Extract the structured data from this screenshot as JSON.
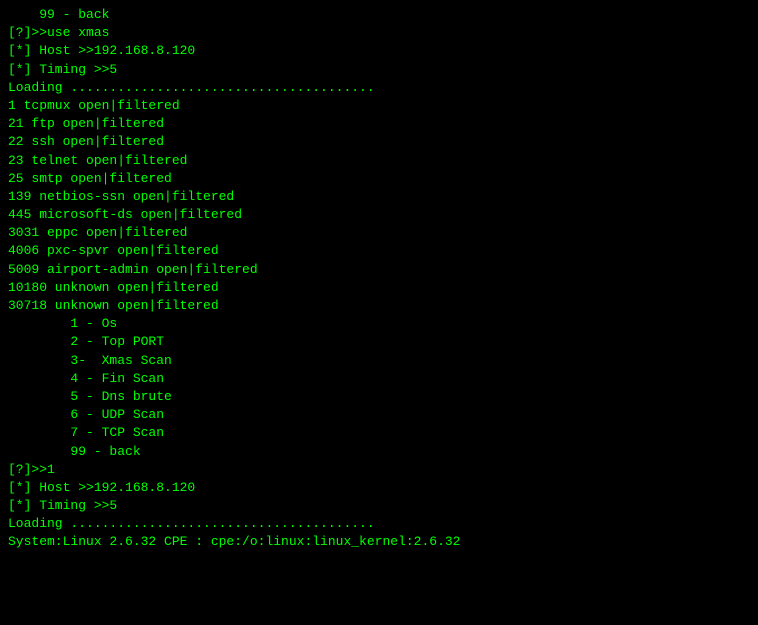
{
  "terminal": {
    "lines": [
      "    99 - back",
      "",
      "[?]>>use xmas",
      "[*] Host >>192.168.8.120",
      "[*] Timing >>5",
      "Loading .......................................",
      "1 tcpmux open|filtered",
      "21 ftp open|filtered",
      "22 ssh open|filtered",
      "23 telnet open|filtered",
      "25 smtp open|filtered",
      "139 netbios-ssn open|filtered",
      "445 microsoft-ds open|filtered",
      "3031 eppc open|filtered",
      "4006 pxc-spvr open|filtered",
      "5009 airport-admin open|filtered",
      "10180 unknown open|filtered",
      "30718 unknown open|filtered",
      "",
      "        1 - Os",
      "        2 - Top PORT",
      "        3-  Xmas Scan",
      "        4 - Fin Scan",
      "        5 - Dns brute",
      "        6 - UDP Scan",
      "        7 - TCP Scan",
      "        99 - back",
      "",
      "[?]>>1",
      "[*] Host >>192.168.8.120",
      "[*] Timing >>5",
      "Loading .......................................",
      "System:Linux 2.6.32 CPE : cpe:/o:linux:linux_kernel:2.6.32"
    ]
  }
}
